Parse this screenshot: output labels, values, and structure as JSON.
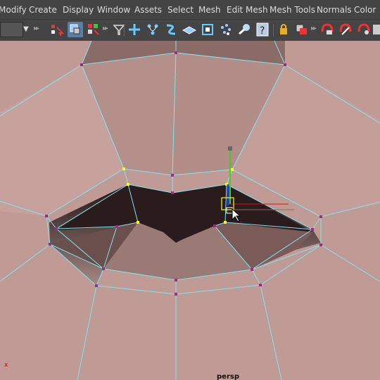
{
  "menu": {
    "items": [
      "Modify",
      "Create",
      "Display",
      "Window",
      "Assets",
      "Select",
      "Mesh",
      "Edit Mesh",
      "Mesh Tools",
      "Normals",
      "Color"
    ]
  },
  "shelf": {
    "icons": [
      "select-by-hierarchy-icon",
      "select-by-object-icon",
      "select-by-component-icon",
      "funnel-icon",
      "snap-grid-icon",
      "snap-curve-icon",
      "snap-point-icon",
      "snap-plane-icon",
      "snap-surface-icon",
      "snap-vertex-icon",
      "magnet-icon",
      "help-icon",
      "lock-icon",
      "selection-lock-icon",
      "history-icon",
      "construction-history-icon",
      "render-icon"
    ]
  },
  "viewport": {
    "camera_label": "persp",
    "axis_label": "x",
    "colors": {
      "background": "#c09a94",
      "wire": "#7fe6ee",
      "vertex": "#a0288a",
      "vertex_selected": "#ffff00",
      "manip_y": "#44cc22",
      "manip_x": "#dd1111",
      "manip_z": "#2244dd"
    }
  }
}
